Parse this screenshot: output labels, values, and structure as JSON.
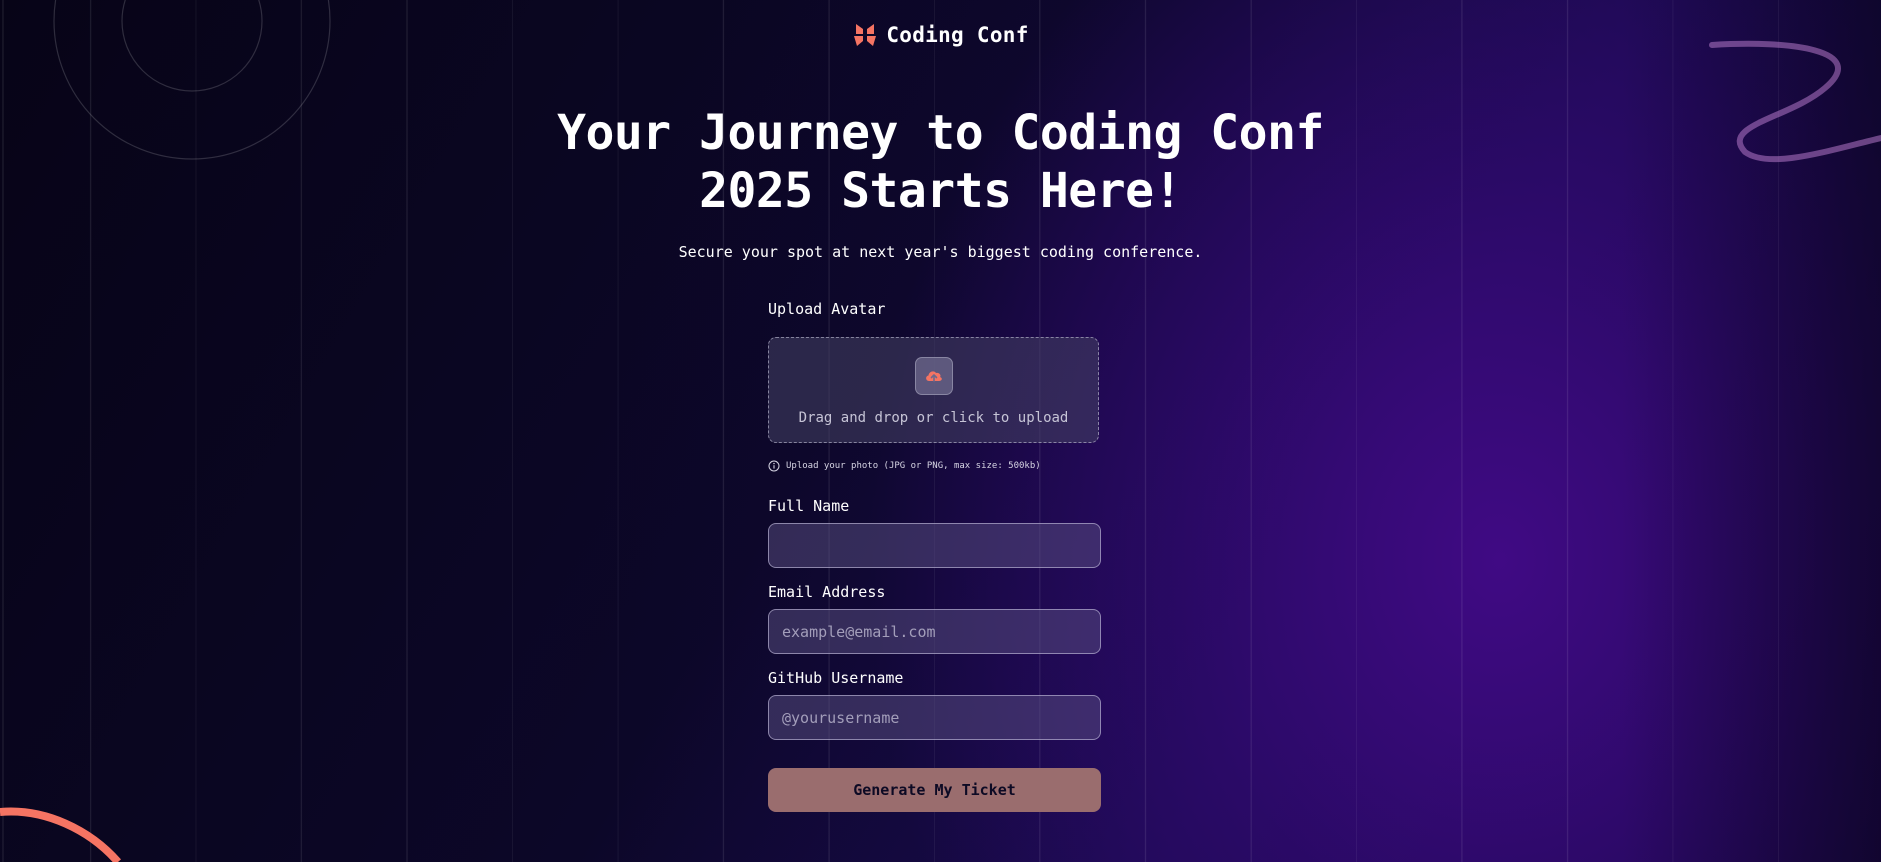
{
  "brand": {
    "name": "Coding Conf",
    "accent_color": "#f57463",
    "logo_icon": "coding-conf-logo-icon"
  },
  "hero": {
    "title_line1": "Your Journey to Coding Conf",
    "title_line2": "2025 Starts Here!",
    "subtitle": "Secure your spot at next year's biggest coding conference."
  },
  "form": {
    "avatar_label": "Upload Avatar",
    "upload_text": "Drag and drop or click to upload",
    "upload_icon": "upload-cloud-icon",
    "upload_hint": "Upload your photo (JPG or PNG, max size: 500kb)",
    "hint_icon": "info-icon",
    "full_name_label": "Full Name",
    "full_name_value": "",
    "full_name_placeholder": "",
    "email_label": "Email Address",
    "email_placeholder": "example@email.com",
    "github_label": "GitHub Username",
    "github_placeholder": "@yourusername",
    "submit_label": "Generate My Ticket"
  }
}
